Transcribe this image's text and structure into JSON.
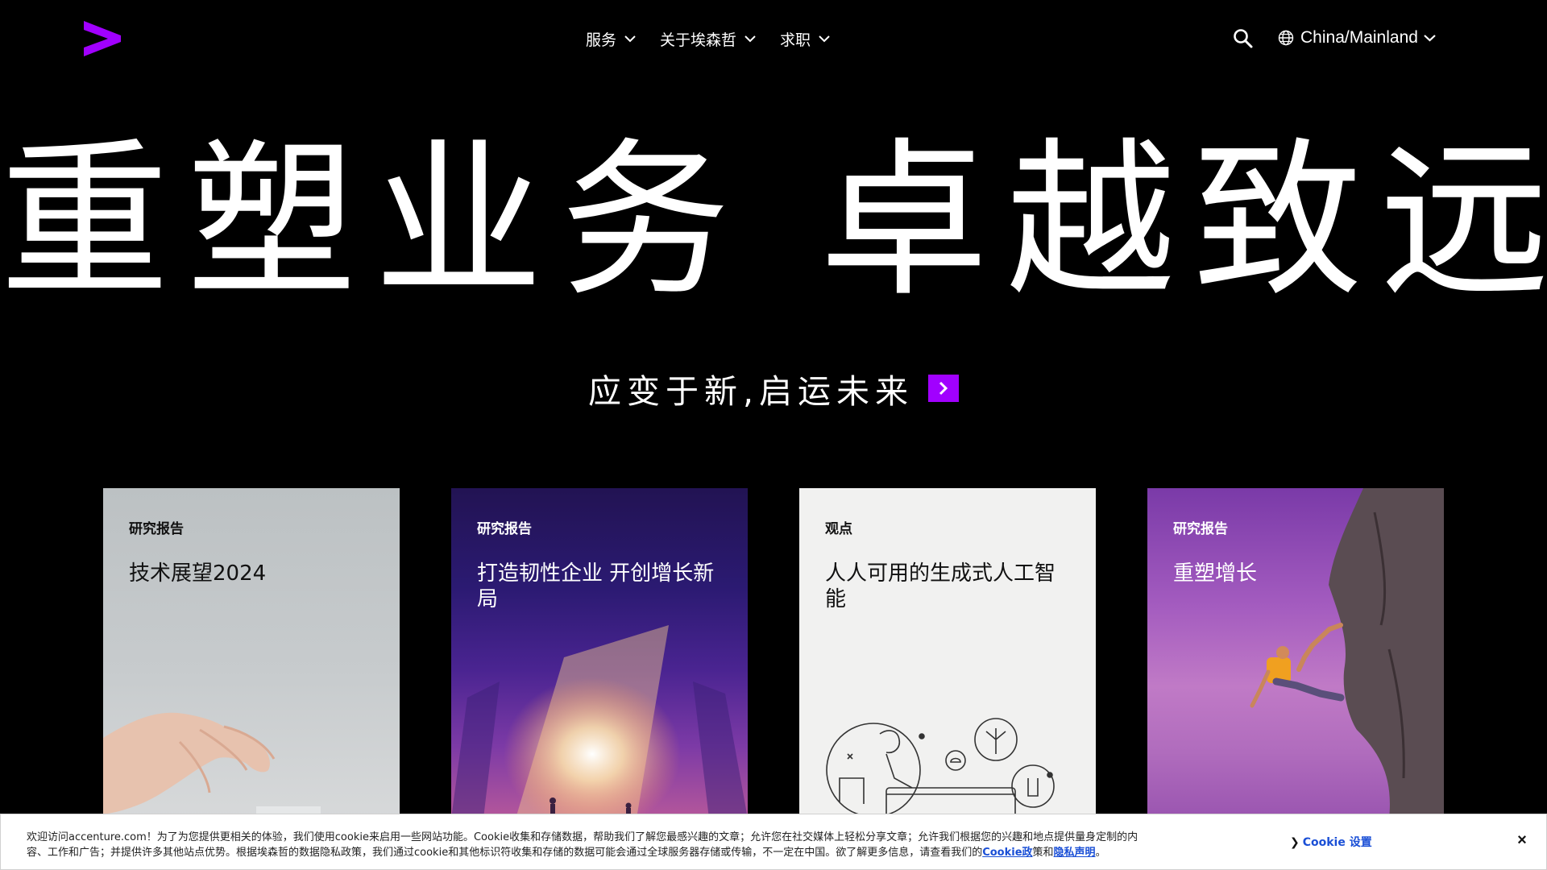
{
  "brand": {
    "accent": "#a100ff"
  },
  "nav": {
    "items": [
      {
        "label": "服务"
      },
      {
        "label": "关于埃森哲"
      },
      {
        "label": "求职"
      }
    ]
  },
  "country": {
    "label": "China/Mainland"
  },
  "hero": {
    "title": "重塑业务 卓越致远",
    "cta": "应变于新,启运未来"
  },
  "cards": [
    {
      "tag": "研究报告",
      "title": "技术展望2024"
    },
    {
      "tag": "研究报告",
      "title": "打造韧性企业 开创增长新局"
    },
    {
      "tag": "观点",
      "title": "人人可用的生成式人工智能"
    },
    {
      "tag": "研究报告",
      "title": "重塑增长"
    }
  ],
  "cookie": {
    "text": "欢迎访问accenture.com！为了为您提供更相关的体验，我们使用cookie来启用一些网站功能。Cookie收集和存储数据，帮助我们了解您最感兴趣的文章；允许您在社交媒体上轻松分享文章；允许我们根据您的兴趣和地点提供量身定制的内容、工作和广告；并提供许多其他站点优势。根据埃森哲的数据隐私政策，我们通过cookie和其他标识符收集和存储的数据可能会通过全球服务器存储或传输，不一定在中国。欲了解更多信息，请查看我们的",
    "link1": "Cookie政",
    "mid": "策和",
    "link2": "隐私声明",
    "end": "。",
    "settings": "Cookie 设置",
    "close": "×"
  }
}
